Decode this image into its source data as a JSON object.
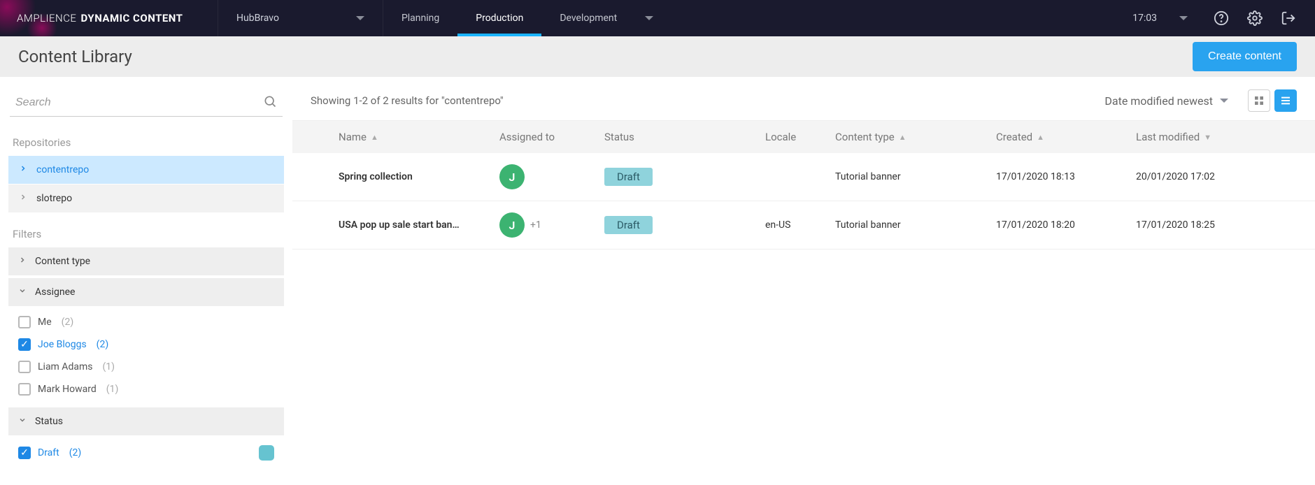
{
  "brand": {
    "thin": "AMPLIENCE",
    "bold": "DYNAMIC CONTENT"
  },
  "hub": {
    "name": "HubBravo"
  },
  "nav": {
    "planning": "Planning",
    "production": "Production",
    "development": "Development"
  },
  "time": "17:03",
  "page": {
    "title": "Content Library",
    "create": "Create content"
  },
  "search": {
    "placeholder": "Search"
  },
  "sidebar": {
    "repos_label": "Repositories",
    "repos": [
      {
        "name": "contentrepo",
        "active": true
      },
      {
        "name": "slotrepo",
        "active": false
      }
    ],
    "filters_label": "Filters",
    "content_type_label": "Content type",
    "assignee_label": "Assignee",
    "assignees": [
      {
        "name": "Me",
        "count": "(2)",
        "checked": false
      },
      {
        "name": "Joe Bloggs",
        "count": "(2)",
        "checked": true
      },
      {
        "name": "Liam Adams",
        "count": "(1)",
        "checked": false
      },
      {
        "name": "Mark Howard",
        "count": "(1)",
        "checked": false
      }
    ],
    "status_label": "Status",
    "statuses": [
      {
        "name": "Draft",
        "count": "(2)",
        "checked": true,
        "color": "#66c3d0"
      }
    ]
  },
  "results": {
    "summary": "Showing 1-2 of 2 results for \"contentrepo\"",
    "sort": "Date modified newest"
  },
  "columns": {
    "name": "Name",
    "assigned": "Assigned to",
    "status": "Status",
    "locale": "Locale",
    "ctype": "Content type",
    "created": "Created",
    "modified": "Last modified"
  },
  "rows": [
    {
      "name": "Spring collection",
      "avatar": "J",
      "more": "",
      "status": "Draft",
      "locale": "",
      "ctype": "Tutorial banner",
      "created": "17/01/2020 18:13",
      "modified": "20/01/2020 17:02"
    },
    {
      "name": "USA pop up sale start ban…",
      "avatar": "J",
      "more": "+1",
      "status": "Draft",
      "locale": "en-US",
      "ctype": "Tutorial banner",
      "created": "17/01/2020 18:20",
      "modified": "17/01/2020 18:25"
    }
  ]
}
